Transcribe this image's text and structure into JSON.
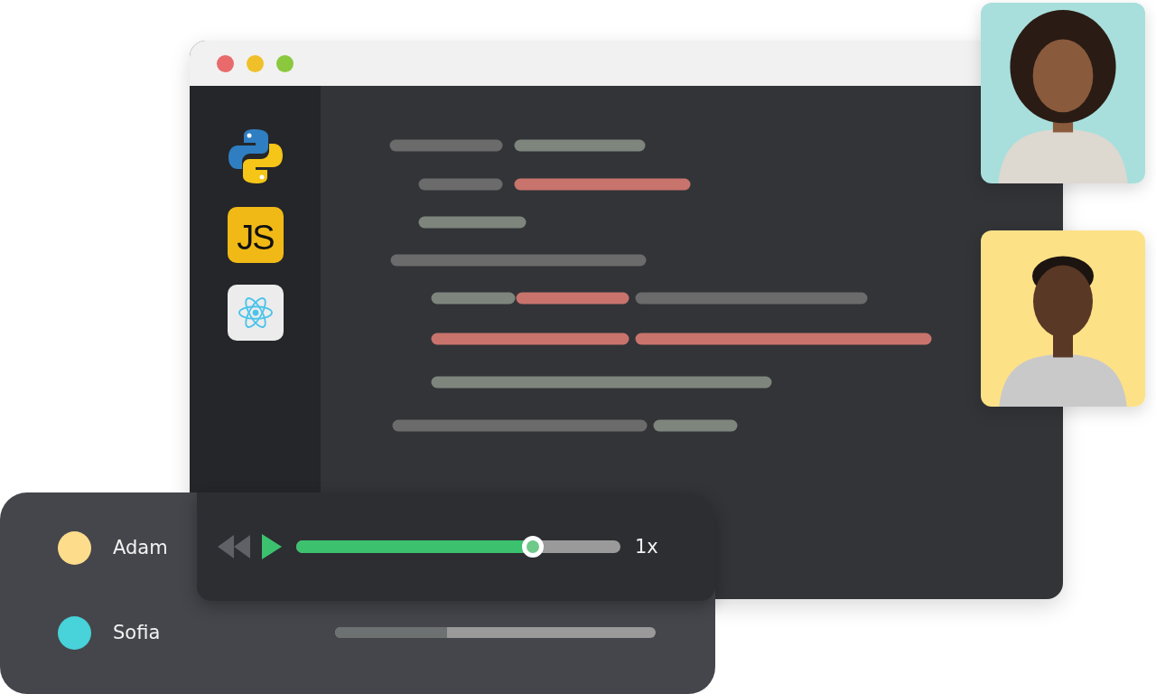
{
  "window": {
    "sidebar": {
      "items": [
        {
          "kind": "python"
        },
        {
          "kind": "js",
          "label": "JS"
        },
        {
          "kind": "react"
        }
      ]
    }
  },
  "player": {
    "level": 0.73,
    "speed": "1x"
  },
  "participants": [
    {
      "name": "Adam",
      "color": "#fddc8b"
    },
    {
      "name": "Sofia",
      "color": "#48d2d9",
      "level": 0.35
    }
  ]
}
